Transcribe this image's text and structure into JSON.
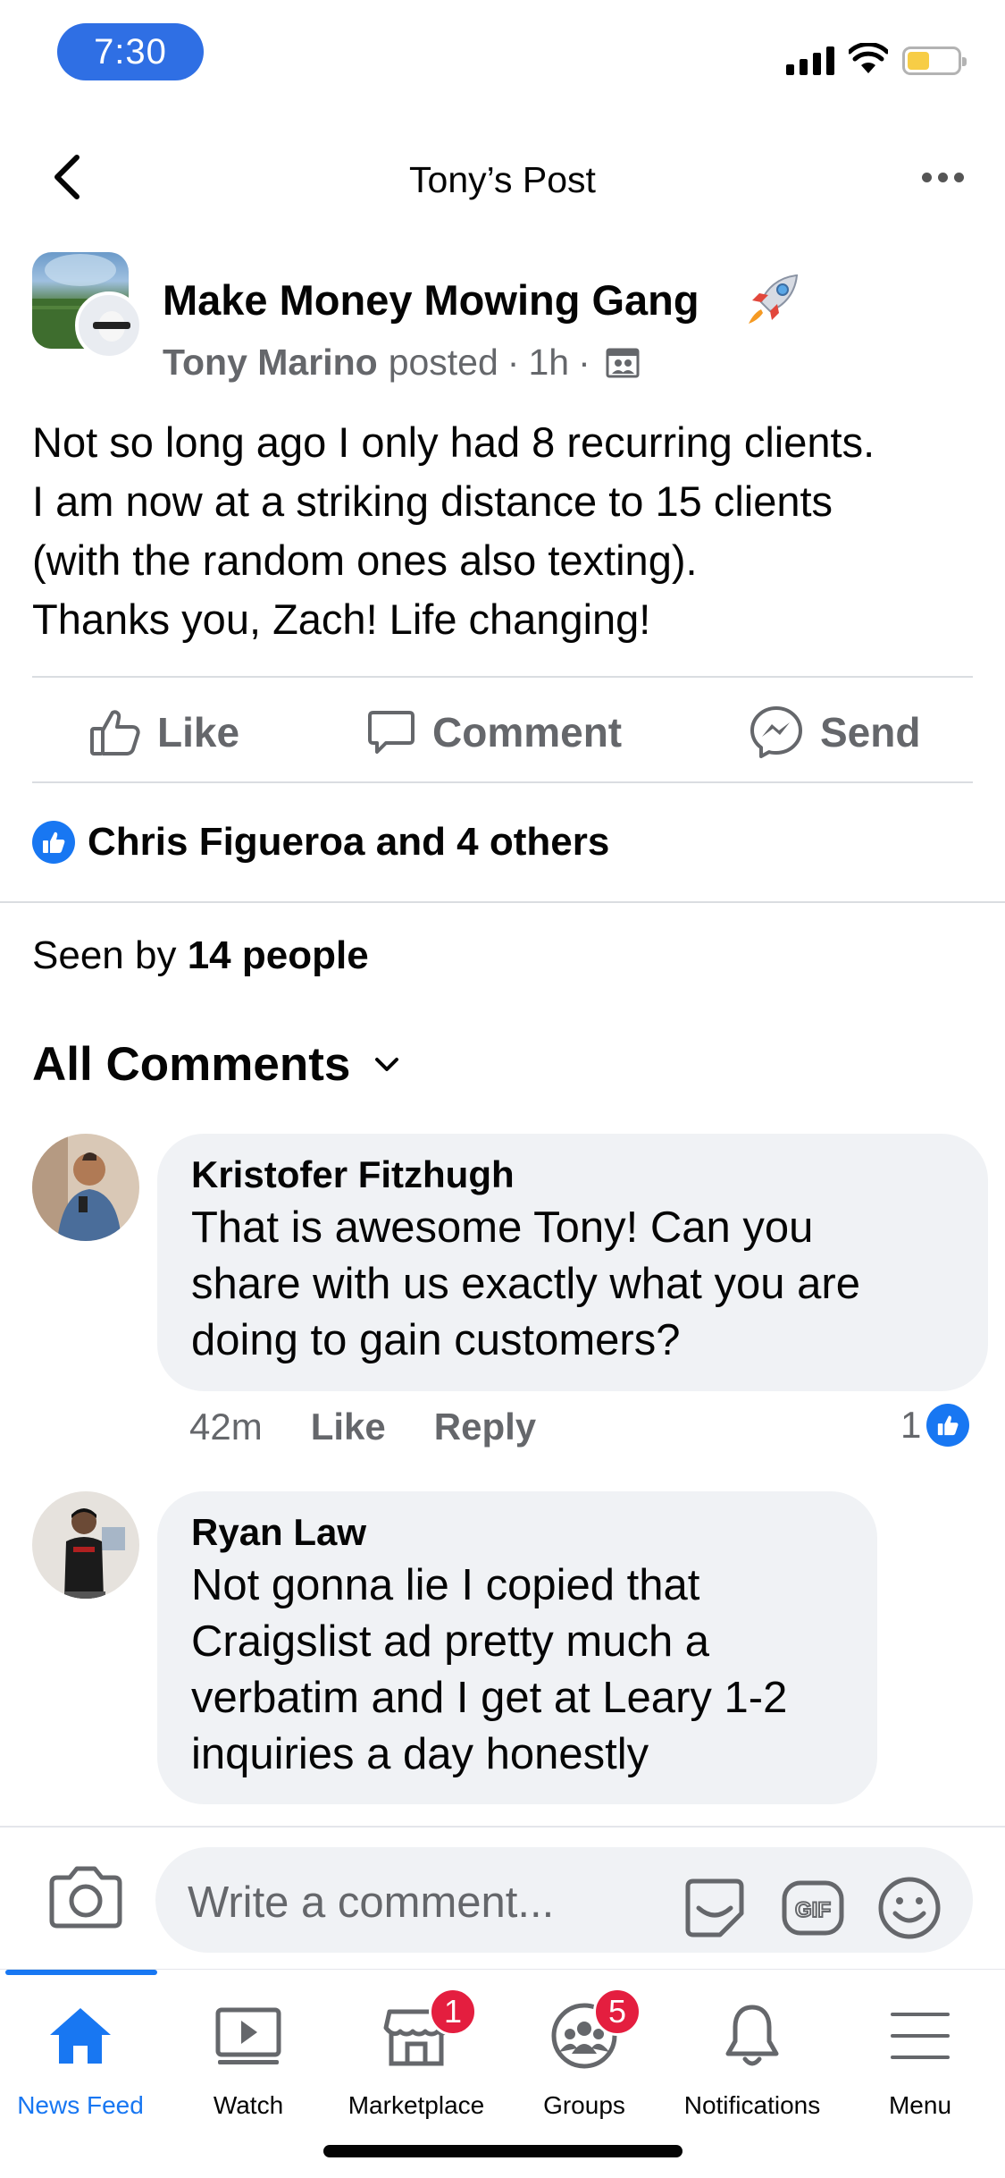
{
  "status_bar": {
    "time": "7:30"
  },
  "header": {
    "title": "Tony’s Post"
  },
  "post": {
    "group_name": "Make Money Mowing Gang",
    "author": "Tony Marino",
    "posted_label": "posted",
    "separator": "·",
    "age": "1h",
    "body_lines": [
      "Not so long ago I only had 8 recurring clients.",
      "I am now at a striking distance to 15 clients",
      "(with the random ones also texting).",
      "Thanks you, Zach! Life changing!"
    ]
  },
  "actions": {
    "like": "Like",
    "comment": "Comment",
    "send": "Send"
  },
  "reactions": {
    "summary": "Chris Figueroa and 4 others"
  },
  "seen": {
    "prefix": "Seen by",
    "count": "14 people"
  },
  "comments_section": {
    "filter_label": "All Comments",
    "comments": [
      {
        "author": "Kristofer Fitzhugh",
        "text_lines": [
          "That is awesome Tony! Can you",
          "share with us exactly what you are",
          "doing to gain customers?"
        ],
        "time": "42m",
        "like_label": "Like",
        "reply_label": "Reply",
        "reaction_count": "1"
      },
      {
        "author": "Ryan Law",
        "text_lines": [
          "Not gonna lie I copied that",
          "Craigslist ad pretty much a",
          "verbatim and I get at Leary 1-2",
          "inquiries a day honestly"
        ]
      }
    ]
  },
  "composer": {
    "placeholder": "Write a comment..."
  },
  "tabbar": {
    "tabs": [
      {
        "label": "News Feed",
        "icon": "home-icon",
        "active": true
      },
      {
        "label": "Watch",
        "icon": "video-icon"
      },
      {
        "label": "Marketplace",
        "icon": "shop-icon",
        "badge": "1"
      },
      {
        "label": "Groups",
        "icon": "groups-icon",
        "badge": "5"
      },
      {
        "label": "Notifications",
        "icon": "bell-icon"
      },
      {
        "label": "Menu",
        "icon": "menu-icon"
      }
    ]
  },
  "colors": {
    "accent": "#1877f2",
    "secondary_text": "#65676b",
    "bubble_bg": "#f0f2f5",
    "badge": "#e41e3f",
    "time_pill": "#2f6fe4"
  }
}
